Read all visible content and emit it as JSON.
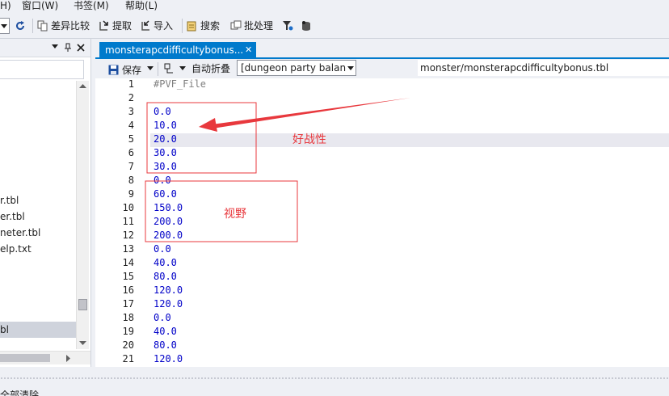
{
  "menu": {
    "item_h_suffix": "H)",
    "window": "窗口(W)",
    "bookmark": "书签(M)",
    "help": "帮助(L)"
  },
  "toolbar": {
    "diff": "差异比较",
    "extract": "提取",
    "import": "导入",
    "search": "搜索",
    "batch": "批处理"
  },
  "sidebar": {
    "files": [
      "r.tbl",
      "er.tbl",
      "neter.tbl",
      "elp.txt"
    ],
    "selected": "bl"
  },
  "editor_tab": {
    "title": "monsterapcdifficultybonus...",
    "close": "✕"
  },
  "editor_toolbar": {
    "save": "保存",
    "autofold": "自动折叠",
    "combo_value": "[dungeon party balan",
    "path": "monster/monsterapcdifficultybonus.tbl"
  },
  "lines": [
    {
      "n": "1",
      "text": "#PVF_File"
    },
    {
      "n": "2",
      "text": ""
    },
    {
      "n": "3",
      "text": "0.0"
    },
    {
      "n": "4",
      "text": "10.0"
    },
    {
      "n": "5",
      "text": "20.0"
    },
    {
      "n": "6",
      "text": "30.0"
    },
    {
      "n": "7",
      "text": "30.0"
    },
    {
      "n": "8",
      "text": "0.0"
    },
    {
      "n": "9",
      "text": "60.0"
    },
    {
      "n": "10",
      "text": "150.0"
    },
    {
      "n": "11",
      "text": "200.0"
    },
    {
      "n": "12",
      "text": "200.0"
    },
    {
      "n": "13",
      "text": "0.0"
    },
    {
      "n": "14",
      "text": "40.0"
    },
    {
      "n": "15",
      "text": "80.0"
    },
    {
      "n": "16",
      "text": "120.0"
    },
    {
      "n": "17",
      "text": "120.0"
    },
    {
      "n": "18",
      "text": "0.0"
    },
    {
      "n": "19",
      "text": "40.0"
    },
    {
      "n": "20",
      "text": "80.0"
    },
    {
      "n": "21",
      "text": "120.0"
    }
  ],
  "annotations": {
    "aggression": "好战性",
    "vision": "视野",
    "color": "#e8383d"
  },
  "bottom": {
    "label": "全部清除"
  }
}
